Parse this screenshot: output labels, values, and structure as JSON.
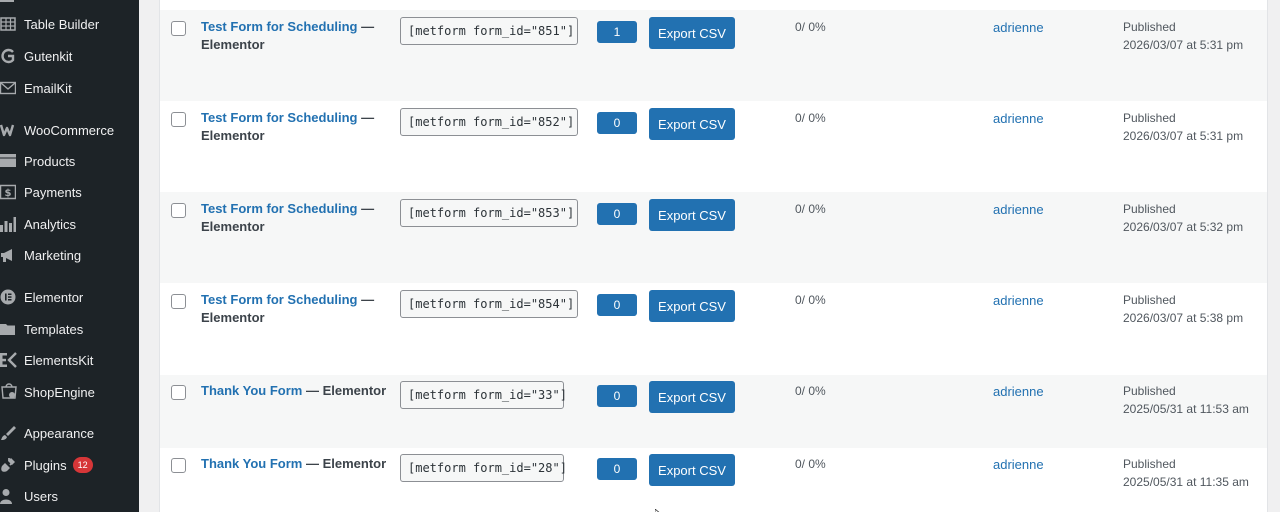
{
  "sidebar": {
    "items": [
      {
        "label": "Table Builder",
        "icon": "table-grid-icon"
      },
      {
        "label": "Gutenkit",
        "icon": "gutenkit-icon"
      },
      {
        "label": "EmailKit",
        "icon": "email-icon"
      },
      {
        "label": "WooCommerce",
        "icon": "woocommerce-icon"
      },
      {
        "label": "Products",
        "icon": "products-icon"
      },
      {
        "label": "Payments",
        "icon": "payments-icon"
      },
      {
        "label": "Analytics",
        "icon": "analytics-icon"
      },
      {
        "label": "Marketing",
        "icon": "megaphone-icon"
      },
      {
        "label": "Elementor",
        "icon": "elementor-icon"
      },
      {
        "label": "Templates",
        "icon": "folder-icon"
      },
      {
        "label": "ElementsKit",
        "icon": "elementskit-icon"
      },
      {
        "label": "ShopEngine",
        "icon": "shopengine-icon"
      },
      {
        "label": "Appearance",
        "icon": "paintbrush-icon"
      },
      {
        "label": "Plugins",
        "icon": "plugin-icon",
        "badge": "12"
      },
      {
        "label": "Users",
        "icon": "users-icon"
      }
    ]
  },
  "table": {
    "title_separator": "—",
    "export_label": "Export CSV",
    "rows": [
      {
        "title": "Test Form for Scheduling",
        "suffix": "Elementor",
        "shortcode": "[metform form_id=\"851\"]",
        "count": "1",
        "entries": "0/ 0%",
        "author": "adrienne",
        "status": "Published",
        "date": "2026/03/07 at 5:31 pm"
      },
      {
        "title": "Test Form for Scheduling",
        "suffix": "Elementor",
        "shortcode": "[metform form_id=\"852\"]",
        "count": "0",
        "entries": "0/ 0%",
        "author": "adrienne",
        "status": "Published",
        "date": "2026/03/07 at 5:31 pm"
      },
      {
        "title": "Test Form for Scheduling",
        "suffix": "Elementor",
        "shortcode": "[metform form_id=\"853\"]",
        "count": "0",
        "entries": "0/ 0%",
        "author": "adrienne",
        "status": "Published",
        "date": "2026/03/07 at 5:32 pm"
      },
      {
        "title": "Test Form for Scheduling",
        "suffix": "Elementor",
        "shortcode": "[metform form_id=\"854\"]",
        "count": "0",
        "entries": "0/ 0%",
        "author": "adrienne",
        "status": "Published",
        "date": "2026/03/07 at 5:38 pm"
      },
      {
        "title": "Thank You Form",
        "suffix": "Elementor",
        "shortcode": "[metform form_id=\"33\"]",
        "count": "0",
        "entries": "0/ 0%",
        "author": "adrienne",
        "status": "Published",
        "date": "2025/05/31 at 11:53 am"
      },
      {
        "title": "Thank You Form",
        "suffix": "Elementor",
        "shortcode": "[metform form_id=\"28\"]",
        "count": "0",
        "entries": "0/ 0%",
        "author": "adrienne",
        "status": "Published",
        "date": "2025/05/31 at 11:35 am"
      }
    ]
  },
  "colors": {
    "sidebar_bg": "#1d2327",
    "primary": "#2271b1",
    "badge": "#d63638"
  }
}
